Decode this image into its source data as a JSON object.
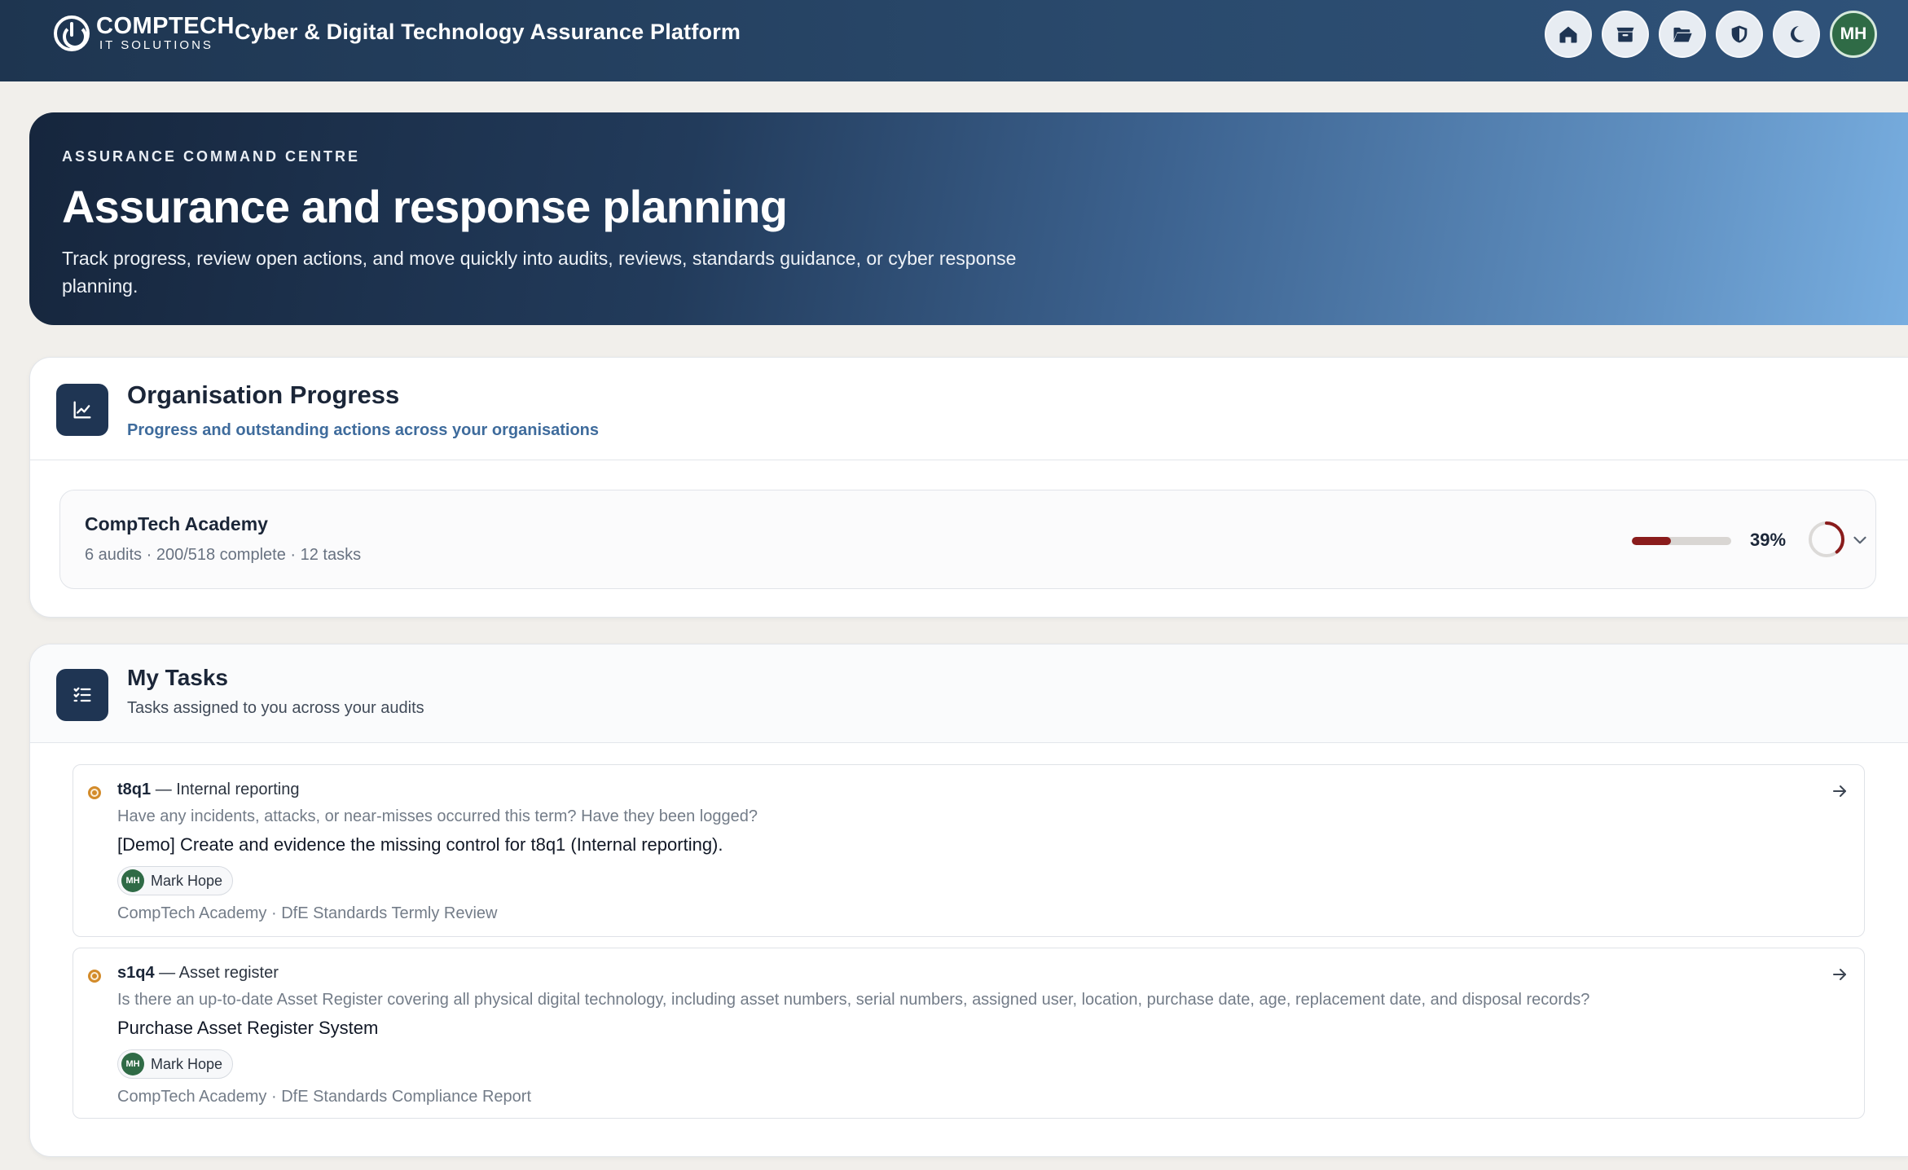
{
  "header": {
    "logo_name": "COMPTECH",
    "logo_sub": "IT SOLUTIONS",
    "app_title": "Cyber & Digital Technology Assurance Platform",
    "icons": [
      "home-icon",
      "box-icon",
      "folder-icon",
      "shield-icon",
      "moon-icon"
    ],
    "avatar_initials": "MH"
  },
  "hero": {
    "eyebrow": "ASSURANCE COMMAND CENTRE",
    "title": "Assurance and response planning",
    "description": "Track progress, review open actions, and move quickly into audits, reviews, standards guidance, or cyber response planning."
  },
  "org_progress": {
    "title": "Organisation Progress",
    "subtitle": "Progress and outstanding actions across your organisations",
    "icon": "chart-line-icon",
    "orgs": [
      {
        "name": "CompTech Academy",
        "meta": "6 audits · 200/518 complete · 12 tasks",
        "percent_label": "39%",
        "progress": 0.39,
        "progress_color": "#8a1c1c"
      }
    ]
  },
  "tasks": {
    "title": "My Tasks",
    "subtitle": "Tasks assigned to you across your audits",
    "icon": "task-list-icon",
    "status_color": "#d38b2a",
    "items": [
      {
        "code": "t8q1",
        "category": "— Internal reporting",
        "question": "Have any incidents, attacks, or near-misses occurred this term? Have they been logged?",
        "action": "[Demo] Create and evidence the missing control for t8q1 (Internal reporting).",
        "assignee_initials": "MH",
        "assignee": "Mark Hope",
        "source": "CompTech Academy · DfE Standards Termly Review"
      },
      {
        "code": "s1q4",
        "category": "— Asset register",
        "question": "Is there an up-to-date Asset Register covering all physical digital technology, including asset numbers, serial numbers, assigned user, location, purchase date, age, replacement date, and disposal records?",
        "action": "Purchase Asset Register System",
        "assignee_initials": "MH",
        "assignee": "Mark Hope",
        "source": "CompTech Academy · DfE Standards Compliance Report"
      }
    ]
  }
}
